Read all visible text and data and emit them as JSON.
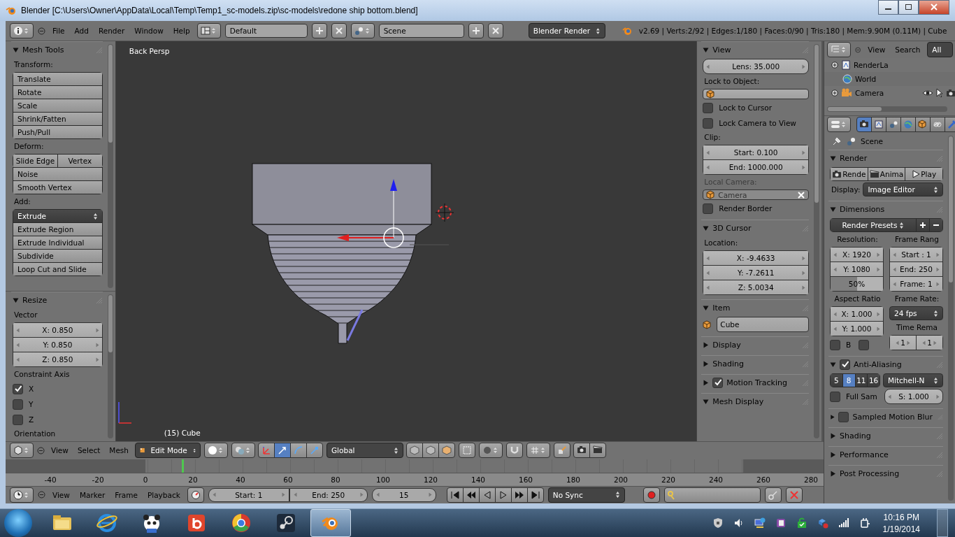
{
  "window": {
    "title": "Blender [C:\\Users\\Owner\\AppData\\Local\\Temp\\Temp1_sc-models.zip\\sc-models\\redone ship bottom.blend]"
  },
  "info_header": {
    "menus": [
      "File",
      "Add",
      "Render",
      "Window",
      "Help"
    ],
    "layout": "Default",
    "scene": "Scene",
    "engine": "Blender Render",
    "stats": "v2.69 | Verts:2/92 | Edges:1/180 | Faces:0/90 | Tris:180 | Mem:9.90M (0.11M) | Cube"
  },
  "tool_shelf": {
    "panels": [
      {
        "title": "Mesh Tools",
        "expanded": true,
        "items": [
          {
            "kind": "label",
            "text": "Transform:"
          },
          {
            "kind": "stack",
            "items": [
              {
                "kind": "button",
                "text": "Translate"
              },
              {
                "kind": "button",
                "text": "Rotate"
              },
              {
                "kind": "button",
                "text": "Scale"
              },
              {
                "kind": "button",
                "text": "Shrink/Fatten"
              },
              {
                "kind": "button",
                "text": "Push/Pull"
              }
            ]
          },
          {
            "kind": "label",
            "text": "Deform:"
          },
          {
            "kind": "stack",
            "items": [
              {
                "kind": "row",
                "items": [
                  {
                    "kind": "button",
                    "text": "Slide Edge"
                  },
                  {
                    "kind": "button",
                    "text": "Vertex"
                  }
                ]
              },
              {
                "kind": "button",
                "text": "Noise"
              },
              {
                "kind": "button",
                "text": "Smooth Vertex"
              }
            ]
          },
          {
            "kind": "label",
            "text": "Add:"
          },
          {
            "kind": "stack",
            "items": [
              {
                "kind": "dropdown",
                "text": "Extrude"
              },
              {
                "kind": "button",
                "text": "Extrude Region"
              },
              {
                "kind": "button",
                "text": "Extrude Individual"
              },
              {
                "kind": "button",
                "text": "Subdivide"
              },
              {
                "kind": "button",
                "text": "Loop Cut and Slide"
              }
            ]
          }
        ]
      },
      {
        "title": "Resize",
        "expanded": true,
        "items": [
          {
            "kind": "label",
            "text": "Vector"
          },
          {
            "kind": "stack",
            "items": [
              {
                "kind": "number",
                "text": "X: 0.850"
              },
              {
                "kind": "number",
                "text": "Y: 0.850"
              },
              {
                "kind": "number",
                "text": "Z: 0.850"
              }
            ]
          },
          {
            "kind": "label",
            "text": "Constraint Axis"
          },
          {
            "kind": "checkbox",
            "text": "X",
            "checked": true
          },
          {
            "kind": "checkbox",
            "text": "Y",
            "checked": false
          },
          {
            "kind": "checkbox",
            "text": "Z",
            "checked": false
          },
          {
            "kind": "label",
            "text": "Orientation"
          }
        ]
      }
    ]
  },
  "viewport": {
    "view_label": "Back Persp",
    "object_label": "(15) Cube"
  },
  "n_panel": {
    "panels": [
      {
        "title": "View",
        "expanded": true,
        "items": [
          {
            "kind": "number",
            "text": "Lens: 35.000"
          },
          {
            "kind": "label",
            "text": "Lock to Object:"
          },
          {
            "kind": "field"
          },
          {
            "kind": "checkbox",
            "text": "Lock to Cursor",
            "checked": false
          },
          {
            "kind": "checkbox",
            "text": "Lock Camera to View",
            "checked": false
          },
          {
            "kind": "label",
            "text": "Clip:"
          },
          {
            "kind": "stack",
            "items": [
              {
                "kind": "number",
                "text": "Start: 0.100"
              },
              {
                "kind": "number",
                "text": "End: 1000.000"
              }
            ]
          },
          {
            "kind": "label",
            "text": "Local Camera:",
            "disabled": true
          },
          {
            "kind": "field",
            "text": "Camera",
            "disabled": true,
            "clear": true
          },
          {
            "kind": "checkbox",
            "text": "Render Border",
            "checked": false
          }
        ]
      },
      {
        "title": "3D Cursor",
        "expanded": true,
        "items": [
          {
            "kind": "label",
            "text": "Location:"
          },
          {
            "kind": "stack",
            "items": [
              {
                "kind": "number",
                "text": "X: -9.4633"
              },
              {
                "kind": "number",
                "text": "Y: -7.2611"
              },
              {
                "kind": "number",
                "text": "Z: 5.0034"
              }
            ]
          }
        ]
      },
      {
        "title": "Item",
        "expanded": true,
        "items": [
          {
            "kind": "name_field",
            "text": "Cube"
          }
        ]
      },
      {
        "title": "Display",
        "expanded": false
      },
      {
        "title": "Shading",
        "expanded": false
      },
      {
        "title": "Motion Tracking",
        "expanded": false,
        "checked": true
      },
      {
        "title": "Mesh Display",
        "expanded": true
      }
    ]
  },
  "view3d_header": {
    "menus": [
      "View",
      "Select",
      "Mesh"
    ],
    "mode": "Edit Mode",
    "manipulators": [
      {
        "selected": false
      },
      {
        "selected": true
      },
      {
        "selected": false
      },
      {
        "selected": false
      }
    ],
    "orientation": "Global"
  },
  "timeline": {
    "ticks": [
      "-40",
      "-20",
      "0",
      "20",
      "40",
      "60",
      "80",
      "100",
      "120",
      "140",
      "160",
      "180",
      "200",
      "220",
      "240",
      "260",
      "280"
    ],
    "playhead": {
      "level": 0.215
    }
  },
  "timeline_header": {
    "menus": [
      "View",
      "Marker",
      "Frame",
      "Playback"
    ],
    "start": "Start: 1",
    "end": "End: 250",
    "frame": "15",
    "sync": "No Sync"
  },
  "outliner": {
    "menus": [
      "View",
      "Search"
    ],
    "filter": "All",
    "items": [
      {
        "kind": "render_layers",
        "text": "RenderLa",
        "expanded": false
      },
      {
        "kind": "world",
        "text": "World"
      },
      {
        "kind": "camera",
        "text": "Camera",
        "expanded": false
      }
    ]
  },
  "properties": {
    "tabs": [
      {
        "selected": true
      },
      {
        "selected": false
      },
      {
        "selected": false
      },
      {
        "selected": false
      },
      {
        "selected": false
      },
      {
        "selected": false
      },
      {
        "selected": false
      }
    ],
    "breadcrumb": "Scene",
    "panels": [
      {
        "title": "Render",
        "expanded": true,
        "items": [
          {
            "kind": "row",
            "items": [
              {
                "kind": "render_button",
                "text": "Rende"
              },
              {
                "kind": "animation_button",
                "text": "Anima"
              },
              {
                "kind": "play_button",
                "text": "Play"
              }
            ]
          },
          {
            "kind": "line",
            "items": [
              {
                "kind": "label",
                "text": "Display:"
              },
              {
                "kind": "dropdown",
                "text": "Image Editor"
              }
            ]
          }
        ]
      },
      {
        "title": "Dimensions",
        "expanded": true,
        "items": [
          {
            "kind": "row",
            "items": [
              {
                "kind": "dropdown",
                "text": "Render Presets"
              },
              {
                "kind": "add_button"
              },
              {
                "kind": "remove_button"
              }
            ]
          },
          {
            "kind": "columns",
            "columns": [
              [
                {
                  "kind": "label",
                  "text": "Resolution:"
                },
                {
                  "kind": "stack",
                  "items": [
                    {
                      "kind": "number",
                      "text": "X: 1920"
                    },
                    {
                      "kind": "number",
                      "text": "Y: 1080"
                    },
                    {
                      "kind": "slider",
                      "text": "50%",
                      "level": 0.5
                    }
                  ]
                },
                {
                  "kind": "label",
                  "text": "Aspect Ratio"
                },
                {
                  "kind": "stack",
                  "items": [
                    {
                      "kind": "number",
                      "text": "X: 1.000"
                    },
                    {
                      "kind": "number",
                      "text": "Y: 1.000"
                    }
                  ]
                },
                {
                  "kind": "line",
                  "items": [
                    {
                      "kind": "checkbox",
                      "text": "B",
                      "checked": false
                    },
                    {
                      "kind": "checkbox",
                      "checked": false
                    }
                  ]
                }
              ],
              [
                {
                  "kind": "label",
                  "text": "Frame Rang"
                },
                {
                  "kind": "stack",
                  "items": [
                    {
                      "kind": "number",
                      "text": "Start : 1"
                    },
                    {
                      "kind": "number",
                      "text": "End: 250"
                    },
                    {
                      "kind": "number",
                      "text": "Frame: 1"
                    }
                  ]
                },
                {
                  "kind": "label",
                  "text": "Frame Rate:"
                },
                {
                  "kind": "dropdown",
                  "text": "24 fps"
                },
                {
                  "kind": "label",
                  "text": "Time Rema"
                },
                {
                  "kind": "row",
                  "items": [
                    {
                      "kind": "number",
                      "text": "1"
                    },
                    {
                      "kind": "number",
                      "text": "1"
                    }
                  ]
                }
              ]
            ]
          }
        ]
      },
      {
        "title": "Anti-Aliasing",
        "expanded": true,
        "checked": true,
        "items": [
          {
            "kind": "line",
            "items": [
              {
                "kind": "row",
                "items": [
                  {
                    "kind": "toggle",
                    "text": "5",
                    "selected": false
                  },
                  {
                    "kind": "toggle",
                    "text": "8",
                    "selected": true
                  },
                  {
                    "kind": "toggle",
                    "text": "11",
                    "selected": false
                  },
                  {
                    "kind": "toggle",
                    "text": "16",
                    "selected": false
                  }
                ]
              },
              {
                "kind": "dropdown",
                "text": "Mitchell-N"
              }
            ]
          },
          {
            "kind": "line",
            "items": [
              {
                "kind": "checkbox",
                "text": "Full Sam",
                "checked": false
              },
              {
                "kind": "number",
                "text": "S: 1.000"
              }
            ]
          }
        ]
      },
      {
        "title": "Sampled Motion Blur",
        "expanded": false,
        "checked": false
      },
      {
        "title": "Shading",
        "expanded": false
      },
      {
        "title": "Performance",
        "expanded": false
      },
      {
        "title": "Post Processing",
        "expanded": false
      }
    ]
  },
  "taskbar": {
    "apps": [
      {
        "selected": false
      },
      {
        "selected": false
      },
      {
        "selected": false
      },
      {
        "selected": false
      },
      {
        "selected": false
      },
      {
        "selected": false
      },
      {
        "selected": true
      }
    ],
    "time": "10:16 PM",
    "date": "1/19/2014"
  }
}
